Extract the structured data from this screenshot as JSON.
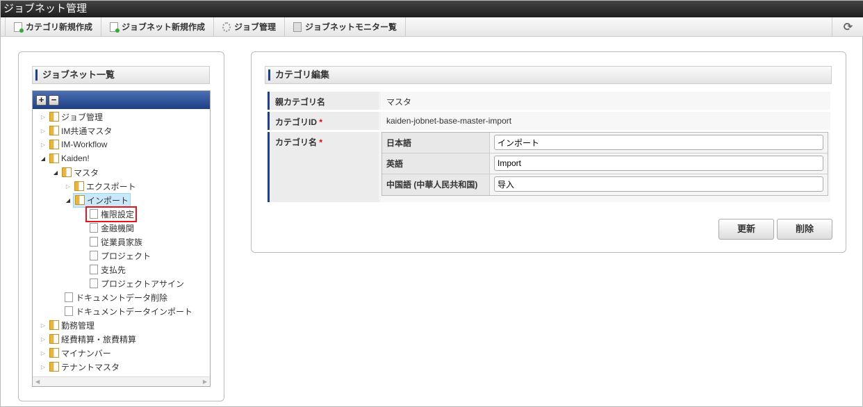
{
  "title": "ジョブネット管理",
  "toolbar": [
    {
      "label": "カテゴリ新規作成",
      "icon": "new-document-icon"
    },
    {
      "label": "ジョブネット新規作成",
      "icon": "new-document-icon"
    },
    {
      "label": "ジョブ管理",
      "icon": "gear-icon"
    },
    {
      "label": "ジョブネットモニター覧",
      "icon": "monitor-icon"
    }
  ],
  "refresh_icon": "⟳",
  "left": {
    "heading": "ジョブネット一覧",
    "expand": "+",
    "collapse": "−",
    "tree": [
      {
        "label": "ジョブ管理",
        "level": 0,
        "type": "folder",
        "state": "closed"
      },
      {
        "label": "IM共通マスタ",
        "level": 0,
        "type": "folder",
        "state": "closed"
      },
      {
        "label": "IM-Workflow",
        "level": 0,
        "type": "folder",
        "state": "closed"
      },
      {
        "label": "Kaiden!",
        "level": 0,
        "type": "folder",
        "state": "open"
      },
      {
        "label": "マスタ",
        "level": 1,
        "type": "folder",
        "state": "open"
      },
      {
        "label": "エクスポート",
        "level": 2,
        "type": "folder",
        "state": "closed"
      },
      {
        "label": "インポート",
        "level": 2,
        "type": "folder",
        "state": "open",
        "selected": true
      },
      {
        "label": "権限設定",
        "level": 3,
        "type": "leaf",
        "highlighted": true
      },
      {
        "label": "金融機関",
        "level": 3,
        "type": "leaf"
      },
      {
        "label": "従業員家族",
        "level": 3,
        "type": "leaf"
      },
      {
        "label": "プロジェクト",
        "level": 3,
        "type": "leaf"
      },
      {
        "label": "支払先",
        "level": 3,
        "type": "leaf"
      },
      {
        "label": "プロジェクトアサイン",
        "level": 3,
        "type": "leaf"
      },
      {
        "label": "ドキュメントデータ削除",
        "level": 1,
        "type": "leaf"
      },
      {
        "label": "ドキュメントデータインポート",
        "level": 1,
        "type": "leaf"
      },
      {
        "label": "勤務管理",
        "level": 0,
        "type": "folder",
        "state": "closed"
      },
      {
        "label": "経費精算・旅費精算",
        "level": 0,
        "type": "folder",
        "state": "closed"
      },
      {
        "label": "マイナンバー",
        "level": 0,
        "type": "folder",
        "state": "closed"
      },
      {
        "label": "テナントマスタ",
        "level": 0,
        "type": "folder",
        "state": "closed"
      }
    ]
  },
  "right": {
    "heading": "カテゴリ編集",
    "parent_label": "親カテゴリ名",
    "parent_value": "マスタ",
    "id_label": "カテゴリID",
    "id_value": "kaiden-jobnet-base-master-import",
    "name_label": "カテゴリ名",
    "required": "*",
    "locales": [
      {
        "label": "日本語",
        "value": "インポート"
      },
      {
        "label": "英語",
        "value": "Import"
      },
      {
        "label": "中国語 (中華人民共和国)",
        "value": "导入"
      }
    ],
    "update": "更新",
    "delete": "削除"
  }
}
